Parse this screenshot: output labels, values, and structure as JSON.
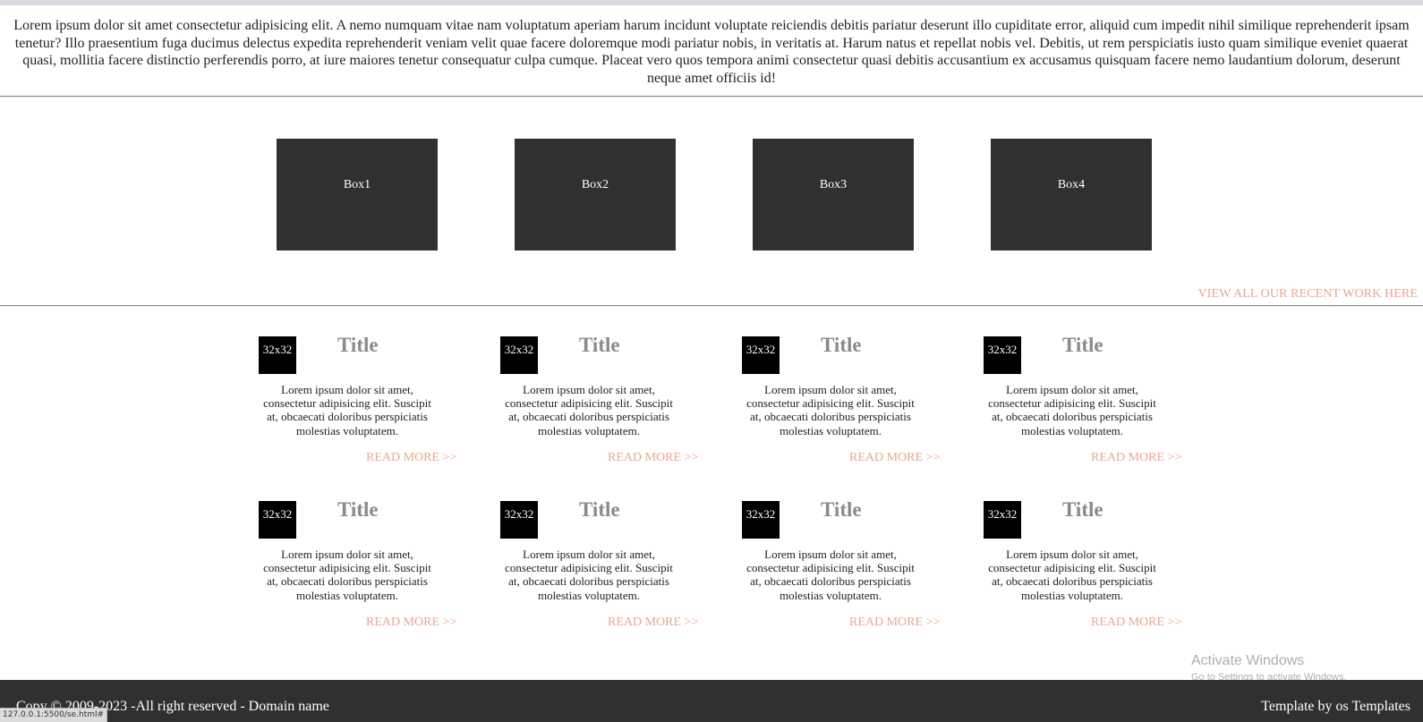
{
  "intro": {
    "text": "Lorem ipsum dolor sit amet consectetur adipisicing elit. A nemo numquam vitae nam voluptatum aperiam harum incidunt voluptate reiciendis debitis pariatur deserunt illo cupiditate error, aliquid cum impedit nihil similique reprehenderit ipsam tenetur? Illo praesentium fuga ducimus delectus expedita reprehenderit veniam velit quae facere doloremque modi pariatur nobis, in veritatis at. Harum natus et repellat nobis vel. Debitis, ut rem perspiciatis iusto quam similique eveniet quaerat quasi, mollitia facere distinctio perferendis porro, at iure maiores tenetur consequatur culpa cumque. Placeat vero quos tempora animi consectetur quasi debitis accusantium ex accusamus quisquam facere nemo laudantium dolorum, deserunt neque amet officiis id!"
  },
  "boxes": [
    "Box1",
    "Box2",
    "Box3",
    "Box4"
  ],
  "view_all_label": "VIEW ALL OUR RECENT WORK HERE",
  "cards": [
    {
      "thumb": "32x32",
      "title": "Title",
      "text": "Lorem ipsum dolor sit amet, consectetur adipisicing elit. Suscipit at, obcaecati doloribus perspiciatis molestias voluptatem.",
      "link": "READ MORE >>"
    },
    {
      "thumb": "32x32",
      "title": "Title",
      "text": "Lorem ipsum dolor sit amet, consectetur adipisicing elit. Suscipit at, obcaecati doloribus perspiciatis molestias voluptatem.",
      "link": "READ MORE >>"
    },
    {
      "thumb": "32x32",
      "title": "Title",
      "text": "Lorem ipsum dolor sit amet, consectetur adipisicing elit. Suscipit at, obcaecati doloribus perspiciatis molestias voluptatem.",
      "link": "READ MORE >>"
    },
    {
      "thumb": "32x32",
      "title": "Title",
      "text": "Lorem ipsum dolor sit amet, consectetur adipisicing elit. Suscipit at, obcaecati doloribus perspiciatis molestias voluptatem.",
      "link": "READ MORE >>"
    },
    {
      "thumb": "32x32",
      "title": "Title",
      "text": "Lorem ipsum dolor sit amet, consectetur adipisicing elit. Suscipit at, obcaecati doloribus perspiciatis molestias voluptatem.",
      "link": "READ MORE >>"
    },
    {
      "thumb": "32x32",
      "title": "Title",
      "text": "Lorem ipsum dolor sit amet, consectetur adipisicing elit. Suscipit at, obcaecati doloribus perspiciatis molestias voluptatem.",
      "link": "READ MORE >>"
    },
    {
      "thumb": "32x32",
      "title": "Title",
      "text": "Lorem ipsum dolor sit amet, consectetur adipisicing elit. Suscipit at, obcaecati doloribus perspiciatis molestias voluptatem.",
      "link": "READ MORE >>"
    },
    {
      "thumb": "32x32",
      "title": "Title",
      "text": "Lorem ipsum dolor sit amet, consectetur adipisicing elit. Suscipit at, obcaecati doloribus perspiciatis molestias voluptatem.",
      "link": "READ MORE >>"
    }
  ],
  "footer": {
    "copyright": "Copy © 2009-2023 -All right reserved - Domain name",
    "credit": "Template by os Templates"
  },
  "status_url": "127.0.0.1:5500/se.html#",
  "watermark": {
    "title": "Activate Windows",
    "subtitle": "Go to Settings to activate Windows."
  },
  "colors": {
    "box_bg": "#303030",
    "link": "#eaa88d",
    "title_gray": "#8a8a8a",
    "footer_bg": "#303030"
  }
}
